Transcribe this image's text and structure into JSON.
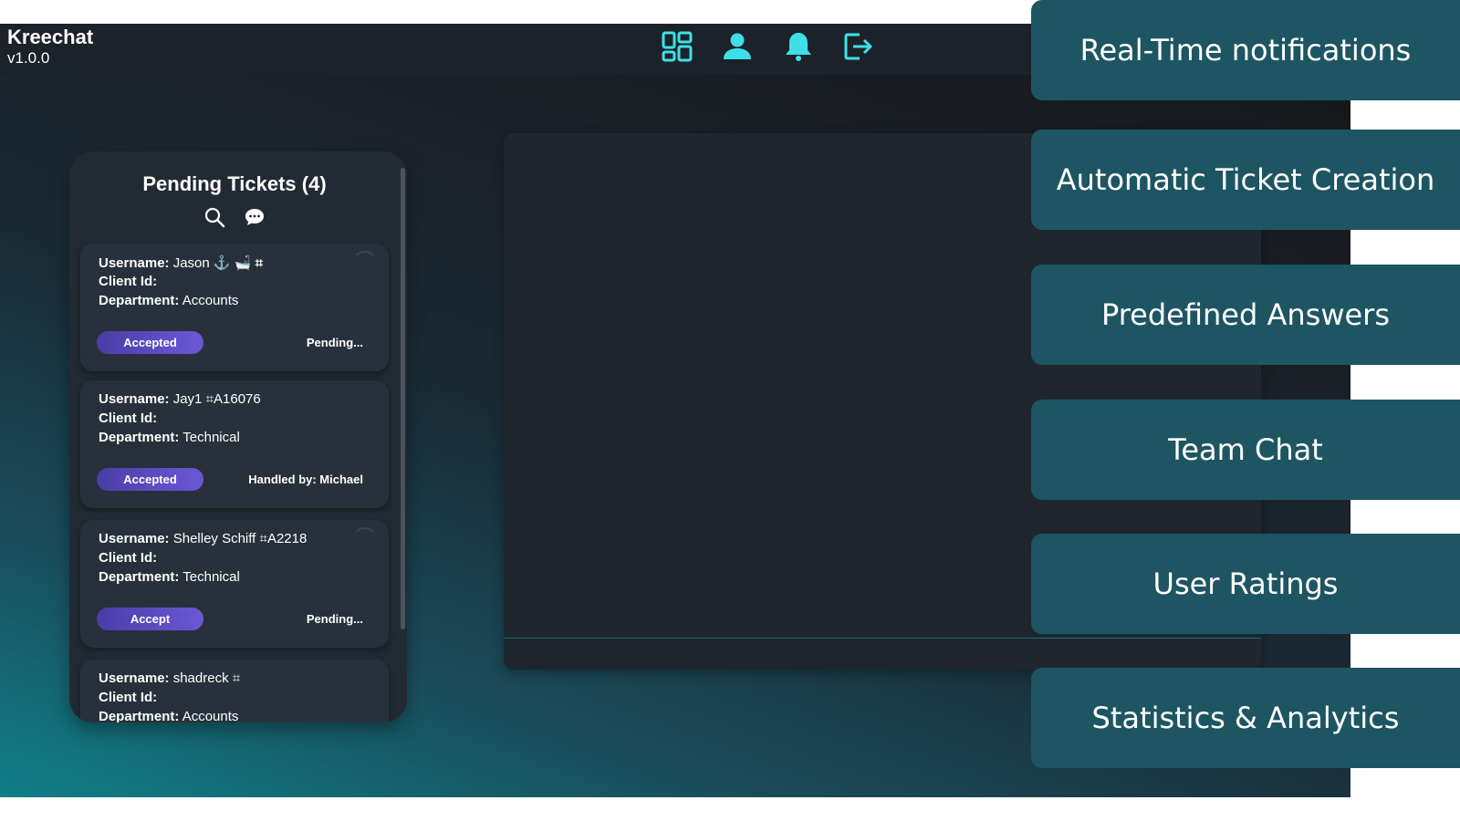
{
  "app": {
    "brand_name": "Kreechat",
    "version": "v1.0.0"
  },
  "nav": {
    "icons": [
      "dashboard-icon",
      "user-icon",
      "bell-icon",
      "logout-icon"
    ],
    "accent_color": "#3ee0e8"
  },
  "tickets_panel": {
    "title": "Pending Tickets (4)",
    "tickets": [
      {
        "username_label": "Username:",
        "username": "Jason",
        "username_suffix": "⚓ 🛁 ⌗",
        "client_label": "Client Id:",
        "client_id": "",
        "department_label": "Department:",
        "department": "Accounts",
        "status": "Accepted",
        "note": "Pending..."
      },
      {
        "username_label": "Username:",
        "username": "Jay1",
        "username_suffix": "⌗A16076",
        "client_label": "Client Id:",
        "client_id": "",
        "department_label": "Department:",
        "department": "Technical",
        "status": "Accepted",
        "note": "Handled by: Michael"
      },
      {
        "username_label": "Username:",
        "username": "Shelley Schiff",
        "username_suffix": "⌗A2218",
        "client_label": "Client Id:",
        "client_id": "",
        "department_label": "Department:",
        "department": "Technical",
        "status": "Accept",
        "note": "Pending..."
      },
      {
        "username_label": "Username:",
        "username": "shadreck",
        "username_suffix": "⌗",
        "client_label": "Client Id:",
        "client_id": "",
        "department_label": "Department:",
        "department": "Accounts"
      }
    ]
  },
  "features": [
    "Real-Time notifications",
    "Automatic Ticket Creation",
    "Predefined Answers",
    "Team Chat",
    "User Ratings",
    "Statistics & Analytics"
  ],
  "colors": {
    "feature_card": "#1e5562",
    "status_pill": "#5a48c4",
    "panel": "#222a33"
  }
}
